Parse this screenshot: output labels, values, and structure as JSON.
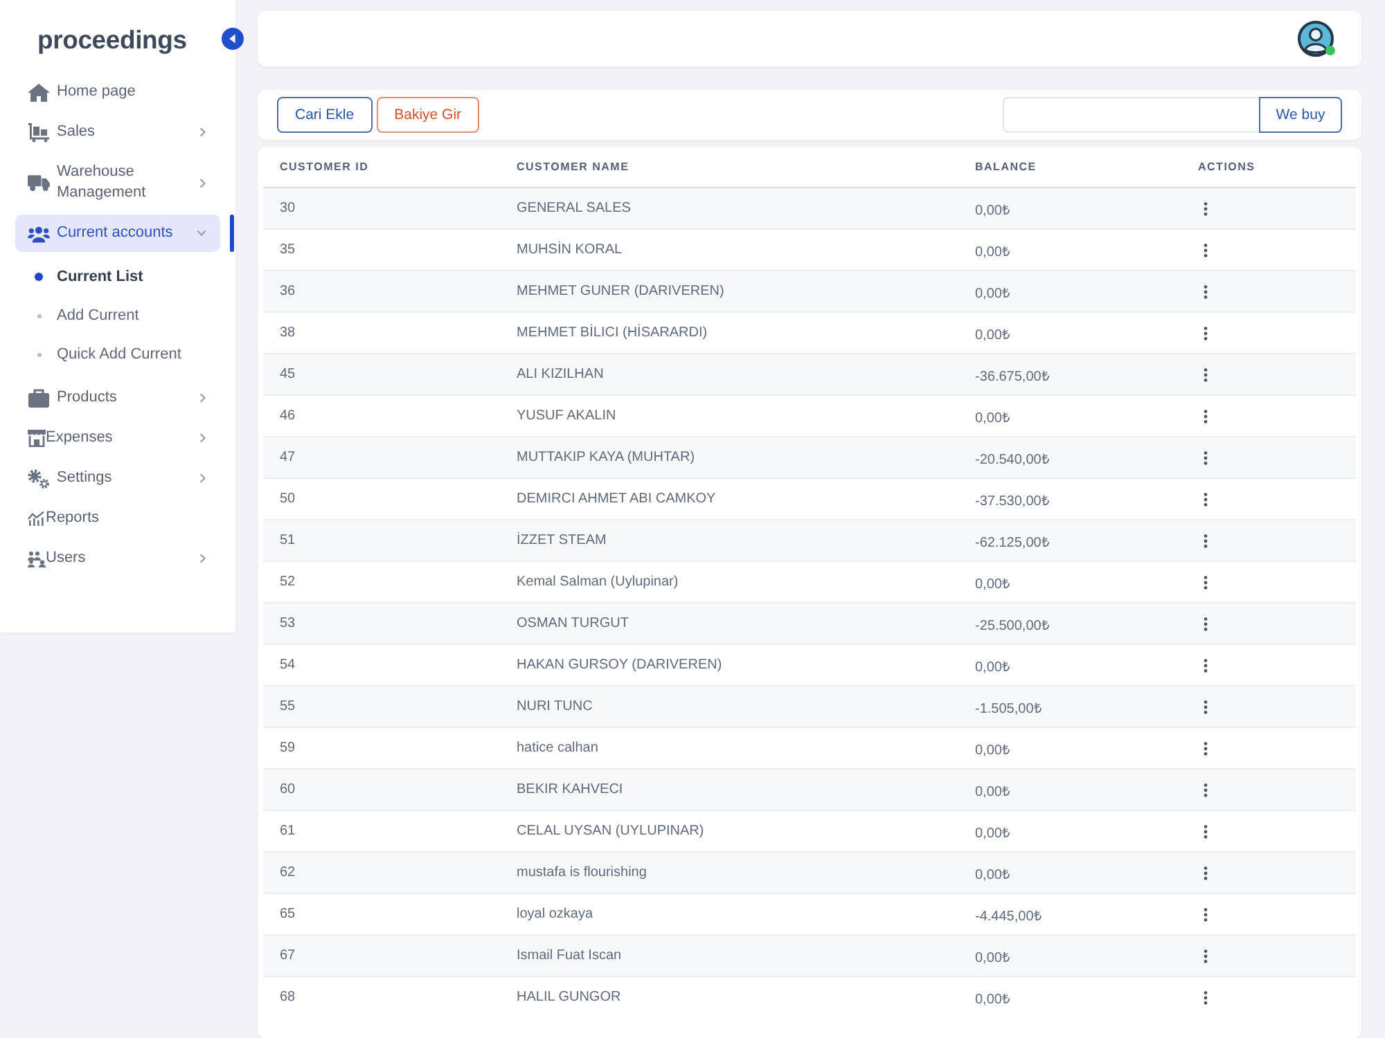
{
  "sidebar": {
    "logo": "proceedings",
    "items": [
      {
        "kind": "link",
        "label": "Home page",
        "selected": false
      },
      {
        "kind": "group",
        "label": "Sales",
        "selected": false,
        "expanded": false
      },
      {
        "kind": "group",
        "label": "Warehouse Management",
        "selected": false,
        "expanded": false
      },
      {
        "kind": "group",
        "label": "Current accounts",
        "selected": true,
        "expanded": true,
        "children": [
          {
            "label": "Current List",
            "selected": true
          },
          {
            "label": "Add Current",
            "selected": false
          },
          {
            "label": "Quick Add Current",
            "selected": false
          }
        ]
      },
      {
        "kind": "group",
        "label": "Products",
        "selected": false,
        "expanded": false
      },
      {
        "kind": "group",
        "label": "Expenses",
        "selected": false,
        "expanded": false
      },
      {
        "kind": "group",
        "label": "Settings",
        "selected": false,
        "expanded": false
      },
      {
        "kind": "link",
        "label": "Reports",
        "selected": false
      },
      {
        "kind": "group",
        "label": "Users",
        "selected": false,
        "expanded": false
      }
    ]
  },
  "header": {
    "avatar": {
      "online": true
    }
  },
  "toolbar": {
    "buttons": [
      {
        "label": "Cari Ekle",
        "kind": "primary"
      },
      {
        "label": "Bakiye Gir",
        "kind": "danger"
      }
    ],
    "search": {
      "button": "We buy"
    }
  },
  "table": {
    "columns": [
      "CUSTOMER ID",
      "CUSTOMER NAME",
      "BALANCE",
      "ACTIONS"
    ],
    "rows": [
      {
        "id": "30",
        "name": "GENERAL SALES",
        "balance": "0,00₺"
      },
      {
        "id": "35",
        "name": "MUHSİN KORAL",
        "balance": "0,00₺"
      },
      {
        "id": "36",
        "name": "MEHMET GUNER (DARIVEREN)",
        "balance": "0,00₺"
      },
      {
        "id": "38",
        "name": "MEHMET BİLICI (HİSARARDI)",
        "balance": "0,00₺"
      },
      {
        "id": "45",
        "name": "ALI KIZILHAN",
        "balance": "-36.675,00₺"
      },
      {
        "id": "46",
        "name": "YUSUF AKALIN",
        "balance": "0,00₺"
      },
      {
        "id": "47",
        "name": "MUTTAKIP KAYA (MUHTAR)",
        "balance": "-20.540,00₺"
      },
      {
        "id": "50",
        "name": "DEMIRCI AHMET ABI CAMKOY",
        "balance": "-37.530,00₺"
      },
      {
        "id": "51",
        "name": "İZZET STEAM",
        "balance": "-62.125,00₺"
      },
      {
        "id": "52",
        "name": "Kemal Salman (Uylupinar)",
        "balance": "0,00₺"
      },
      {
        "id": "53",
        "name": "OSMAN TURGUT",
        "balance": "-25.500,00₺"
      },
      {
        "id": "54",
        "name": "HAKAN GURSOY (DARIVEREN)",
        "balance": "0,00₺"
      },
      {
        "id": "55",
        "name": "NURI TUNC",
        "balance": "-1.505,00₺"
      },
      {
        "id": "59",
        "name": "hatice calhan",
        "balance": "0,00₺"
      },
      {
        "id": "60",
        "name": "BEKIR KAHVECI",
        "balance": "0,00₺"
      },
      {
        "id": "61",
        "name": "CELAL UYSAN (UYLUPINAR)",
        "balance": "0,00₺"
      },
      {
        "id": "62",
        "name": "mustafa is flourishing",
        "balance": "0,00₺"
      },
      {
        "id": "65",
        "name": "loyal ozkaya",
        "balance": "-4.445,00₺"
      },
      {
        "id": "67",
        "name": "Ismail Fuat Iscan",
        "balance": "0,00₺"
      },
      {
        "id": "68",
        "name": "HALIL GUNGOR",
        "balance": "0,00₺"
      }
    ]
  }
}
